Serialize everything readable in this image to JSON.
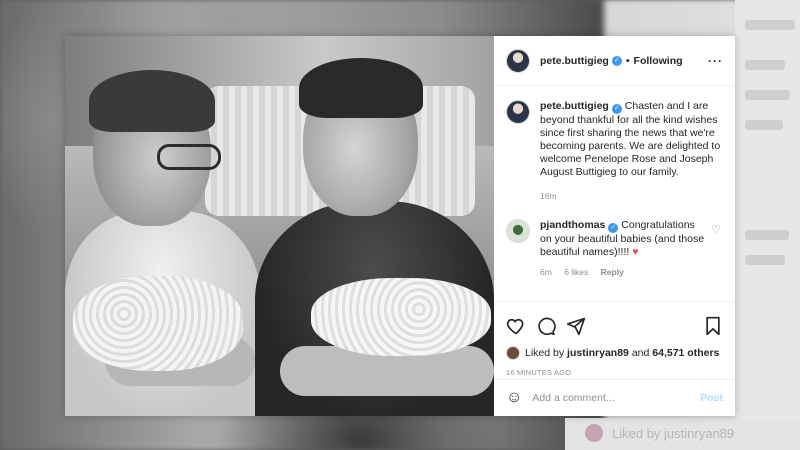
{
  "post": {
    "username": "pete.buttigieg",
    "follow_status": "Following",
    "more_icon": "ellipsis-icon",
    "separator": "•",
    "caption": "Chasten and I are beyond thankful for all the kind wishes since first sharing the news that we're becoming parents. We are delighted to welcome Penelope Rose and Joseph August Buttigieg to our family.",
    "caption_time": "16m"
  },
  "comments": [
    {
      "username": "pjandthomas",
      "text": "Congratulations on your beautiful babies (and those beautiful names)!!!!",
      "emoji": "♥",
      "time": "6m",
      "likes": "6 likes",
      "reply": "Reply"
    }
  ],
  "likes": {
    "prefix": "Liked by",
    "user": "justinryan89",
    "conjunction": "and",
    "count": "64,571 others"
  },
  "posted_time": "16 MINUTES AGO",
  "add_comment": {
    "placeholder": "Add a comment...",
    "post_label": "Post"
  },
  "background": {
    "ghost_text": "Liked by justinryan89"
  },
  "colors": {
    "verified": "#3897f0",
    "heart": "#ed4956",
    "post_disabled": "#b2dffc"
  }
}
